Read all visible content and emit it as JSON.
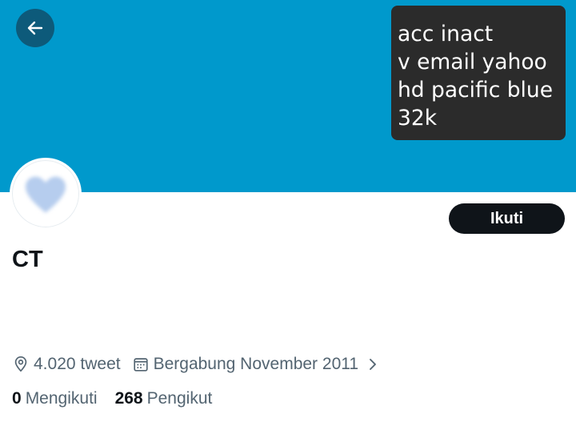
{
  "colors": {
    "banner": "#0099cc",
    "back_button": "#0d5a7a",
    "caption_bg": "#2b2b2b",
    "follow_button": "#0f1419",
    "secondary_text": "#536471",
    "avatar_heart": "#b6cdee"
  },
  "header": {
    "back_icon": "arrow-left-icon"
  },
  "banner_caption": {
    "lines": [
      "acc inact",
      "v email yahoo",
      "hd pacific blue",
      "32k"
    ]
  },
  "profile": {
    "avatar_icon": "heart-icon",
    "follow_label": "Ikuti",
    "name": "CT",
    "tweets": "4.020 tweet",
    "tweets_icon": "location-pin-icon",
    "joined": "Bergabung November 2011",
    "joined_icon": "calendar-icon",
    "more_icon": "chevron-right-icon"
  },
  "stats": {
    "following_count": "0",
    "following_label": "Mengikuti",
    "followers_count": "268",
    "followers_label": "Pengikut"
  }
}
